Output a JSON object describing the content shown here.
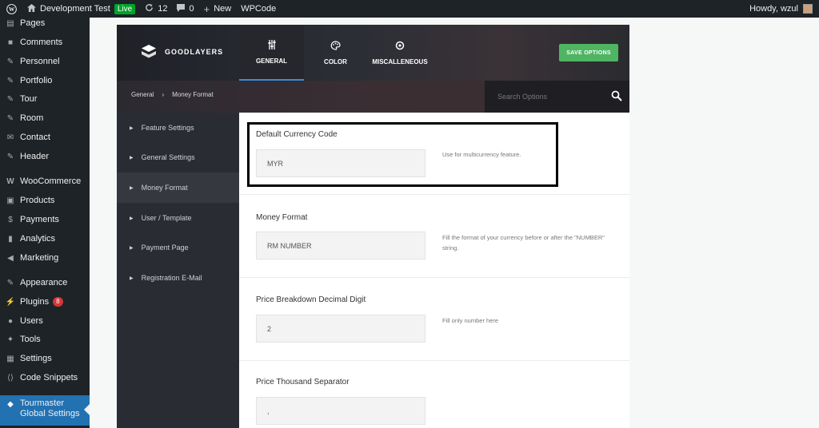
{
  "adminbar": {
    "site_name": "Development Test",
    "live_label": "Live",
    "updates_count": "12",
    "comments_count": "0",
    "new_label": "New",
    "wpcode_label": "WPCode",
    "howdy": "Howdy, wzul"
  },
  "sidebar": {
    "items": [
      {
        "label": "Pages",
        "icon": "pages-icon"
      },
      {
        "label": "Comments",
        "icon": "comments-icon"
      },
      {
        "label": "Personnel",
        "icon": "pin-icon"
      },
      {
        "label": "Portfolio",
        "icon": "pin-icon"
      },
      {
        "label": "Tour",
        "icon": "pin-icon"
      },
      {
        "label": "Room",
        "icon": "pin-icon"
      },
      {
        "label": "Contact",
        "icon": "envelope-icon"
      },
      {
        "label": "Header",
        "icon": "pin-icon"
      },
      {
        "label": "WooCommerce",
        "icon": "woo-icon"
      },
      {
        "label": "Products",
        "icon": "box-icon"
      },
      {
        "label": "Payments",
        "icon": "dollar-icon"
      },
      {
        "label": "Analytics",
        "icon": "bar-chart-icon"
      },
      {
        "label": "Marketing",
        "icon": "megaphone-icon"
      },
      {
        "label": "Appearance",
        "icon": "brush-icon"
      },
      {
        "label": "Plugins",
        "icon": "plug-icon"
      },
      {
        "label": "Users",
        "icon": "user-icon"
      },
      {
        "label": "Tools",
        "icon": "wrench-icon"
      },
      {
        "label": "Settings",
        "icon": "sliders-icon"
      },
      {
        "label": "Code Snippets",
        "icon": "code-icon"
      }
    ],
    "plugins_badge": "8",
    "current": {
      "line1": "Tourmaster",
      "line2": "Global Settings"
    }
  },
  "panel": {
    "brand": "GOODLAYERS",
    "tabs": [
      {
        "label": "GENERAL",
        "icon": "sliders-icon"
      },
      {
        "label": "COLOR",
        "icon": "palette-icon"
      },
      {
        "label": "MISCALLENEOUS",
        "icon": "gear-icon"
      }
    ],
    "save_label": "SAVE OPTIONS"
  },
  "breadcrumb": {
    "parent": "General",
    "separator": "›",
    "current": "Money Format"
  },
  "search": {
    "placeholder": "Search Options"
  },
  "nav": {
    "items": [
      "Feature Settings",
      "General Settings",
      "Money Format",
      "User / Template",
      "Payment Page",
      "Registration E-Mail"
    ],
    "active_index": 2
  },
  "fields": [
    {
      "label": "Default Currency Code",
      "value": "MYR",
      "desc": "Use for multicurrency feature."
    },
    {
      "label": "Money Format",
      "value": "RM NUMBER",
      "desc": "Fill the format of your currency before or after the \"NUMBER\" string."
    },
    {
      "label": "Price Breakdown Decimal Digit",
      "value": "2",
      "desc": "Fill only number here"
    },
    {
      "label": "Price Thousand Separator",
      "value": ",",
      "desc": ""
    }
  ],
  "colors": {
    "accent": "#2271b1",
    "save": "#4fb562",
    "live": "#00a32a",
    "badge": "#d63638"
  }
}
